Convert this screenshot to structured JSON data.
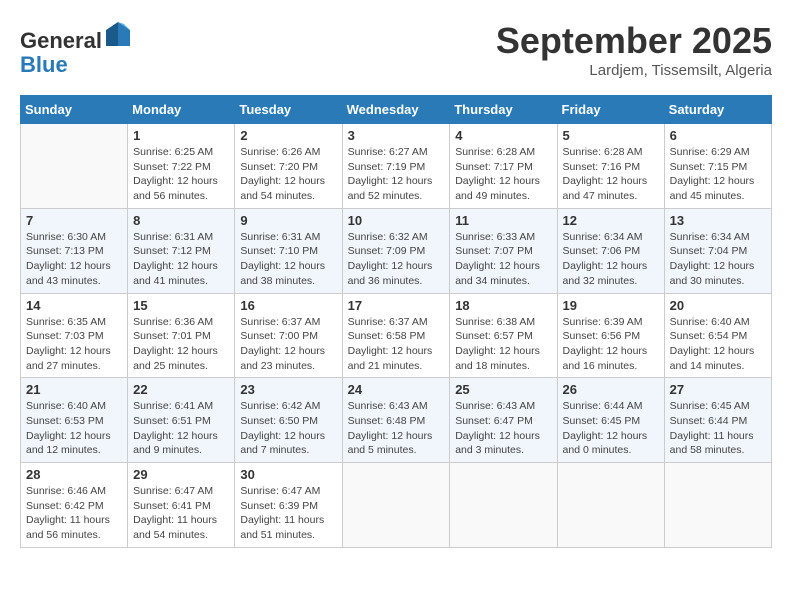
{
  "header": {
    "logo_line1": "General",
    "logo_line2": "Blue",
    "month_title": "September 2025",
    "location": "Lardjem, Tissemsilt, Algeria"
  },
  "weekdays": [
    "Sunday",
    "Monday",
    "Tuesday",
    "Wednesday",
    "Thursday",
    "Friday",
    "Saturday"
  ],
  "weeks": [
    [
      {
        "day": "",
        "info": ""
      },
      {
        "day": "1",
        "info": "Sunrise: 6:25 AM\nSunset: 7:22 PM\nDaylight: 12 hours\nand 56 minutes."
      },
      {
        "day": "2",
        "info": "Sunrise: 6:26 AM\nSunset: 7:20 PM\nDaylight: 12 hours\nand 54 minutes."
      },
      {
        "day": "3",
        "info": "Sunrise: 6:27 AM\nSunset: 7:19 PM\nDaylight: 12 hours\nand 52 minutes."
      },
      {
        "day": "4",
        "info": "Sunrise: 6:28 AM\nSunset: 7:17 PM\nDaylight: 12 hours\nand 49 minutes."
      },
      {
        "day": "5",
        "info": "Sunrise: 6:28 AM\nSunset: 7:16 PM\nDaylight: 12 hours\nand 47 minutes."
      },
      {
        "day": "6",
        "info": "Sunrise: 6:29 AM\nSunset: 7:15 PM\nDaylight: 12 hours\nand 45 minutes."
      }
    ],
    [
      {
        "day": "7",
        "info": "Sunrise: 6:30 AM\nSunset: 7:13 PM\nDaylight: 12 hours\nand 43 minutes."
      },
      {
        "day": "8",
        "info": "Sunrise: 6:31 AM\nSunset: 7:12 PM\nDaylight: 12 hours\nand 41 minutes."
      },
      {
        "day": "9",
        "info": "Sunrise: 6:31 AM\nSunset: 7:10 PM\nDaylight: 12 hours\nand 38 minutes."
      },
      {
        "day": "10",
        "info": "Sunrise: 6:32 AM\nSunset: 7:09 PM\nDaylight: 12 hours\nand 36 minutes."
      },
      {
        "day": "11",
        "info": "Sunrise: 6:33 AM\nSunset: 7:07 PM\nDaylight: 12 hours\nand 34 minutes."
      },
      {
        "day": "12",
        "info": "Sunrise: 6:34 AM\nSunset: 7:06 PM\nDaylight: 12 hours\nand 32 minutes."
      },
      {
        "day": "13",
        "info": "Sunrise: 6:34 AM\nSunset: 7:04 PM\nDaylight: 12 hours\nand 30 minutes."
      }
    ],
    [
      {
        "day": "14",
        "info": "Sunrise: 6:35 AM\nSunset: 7:03 PM\nDaylight: 12 hours\nand 27 minutes."
      },
      {
        "day": "15",
        "info": "Sunrise: 6:36 AM\nSunset: 7:01 PM\nDaylight: 12 hours\nand 25 minutes."
      },
      {
        "day": "16",
        "info": "Sunrise: 6:37 AM\nSunset: 7:00 PM\nDaylight: 12 hours\nand 23 minutes."
      },
      {
        "day": "17",
        "info": "Sunrise: 6:37 AM\nSunset: 6:58 PM\nDaylight: 12 hours\nand 21 minutes."
      },
      {
        "day": "18",
        "info": "Sunrise: 6:38 AM\nSunset: 6:57 PM\nDaylight: 12 hours\nand 18 minutes."
      },
      {
        "day": "19",
        "info": "Sunrise: 6:39 AM\nSunset: 6:56 PM\nDaylight: 12 hours\nand 16 minutes."
      },
      {
        "day": "20",
        "info": "Sunrise: 6:40 AM\nSunset: 6:54 PM\nDaylight: 12 hours\nand 14 minutes."
      }
    ],
    [
      {
        "day": "21",
        "info": "Sunrise: 6:40 AM\nSunset: 6:53 PM\nDaylight: 12 hours\nand 12 minutes."
      },
      {
        "day": "22",
        "info": "Sunrise: 6:41 AM\nSunset: 6:51 PM\nDaylight: 12 hours\nand 9 minutes."
      },
      {
        "day": "23",
        "info": "Sunrise: 6:42 AM\nSunset: 6:50 PM\nDaylight: 12 hours\nand 7 minutes."
      },
      {
        "day": "24",
        "info": "Sunrise: 6:43 AM\nSunset: 6:48 PM\nDaylight: 12 hours\nand 5 minutes."
      },
      {
        "day": "25",
        "info": "Sunrise: 6:43 AM\nSunset: 6:47 PM\nDaylight: 12 hours\nand 3 minutes."
      },
      {
        "day": "26",
        "info": "Sunrise: 6:44 AM\nSunset: 6:45 PM\nDaylight: 12 hours\nand 0 minutes."
      },
      {
        "day": "27",
        "info": "Sunrise: 6:45 AM\nSunset: 6:44 PM\nDaylight: 11 hours\nand 58 minutes."
      }
    ],
    [
      {
        "day": "28",
        "info": "Sunrise: 6:46 AM\nSunset: 6:42 PM\nDaylight: 11 hours\nand 56 minutes."
      },
      {
        "day": "29",
        "info": "Sunrise: 6:47 AM\nSunset: 6:41 PM\nDaylight: 11 hours\nand 54 minutes."
      },
      {
        "day": "30",
        "info": "Sunrise: 6:47 AM\nSunset: 6:39 PM\nDaylight: 11 hours\nand 51 minutes."
      },
      {
        "day": "",
        "info": ""
      },
      {
        "day": "",
        "info": ""
      },
      {
        "day": "",
        "info": ""
      },
      {
        "day": "",
        "info": ""
      }
    ]
  ]
}
